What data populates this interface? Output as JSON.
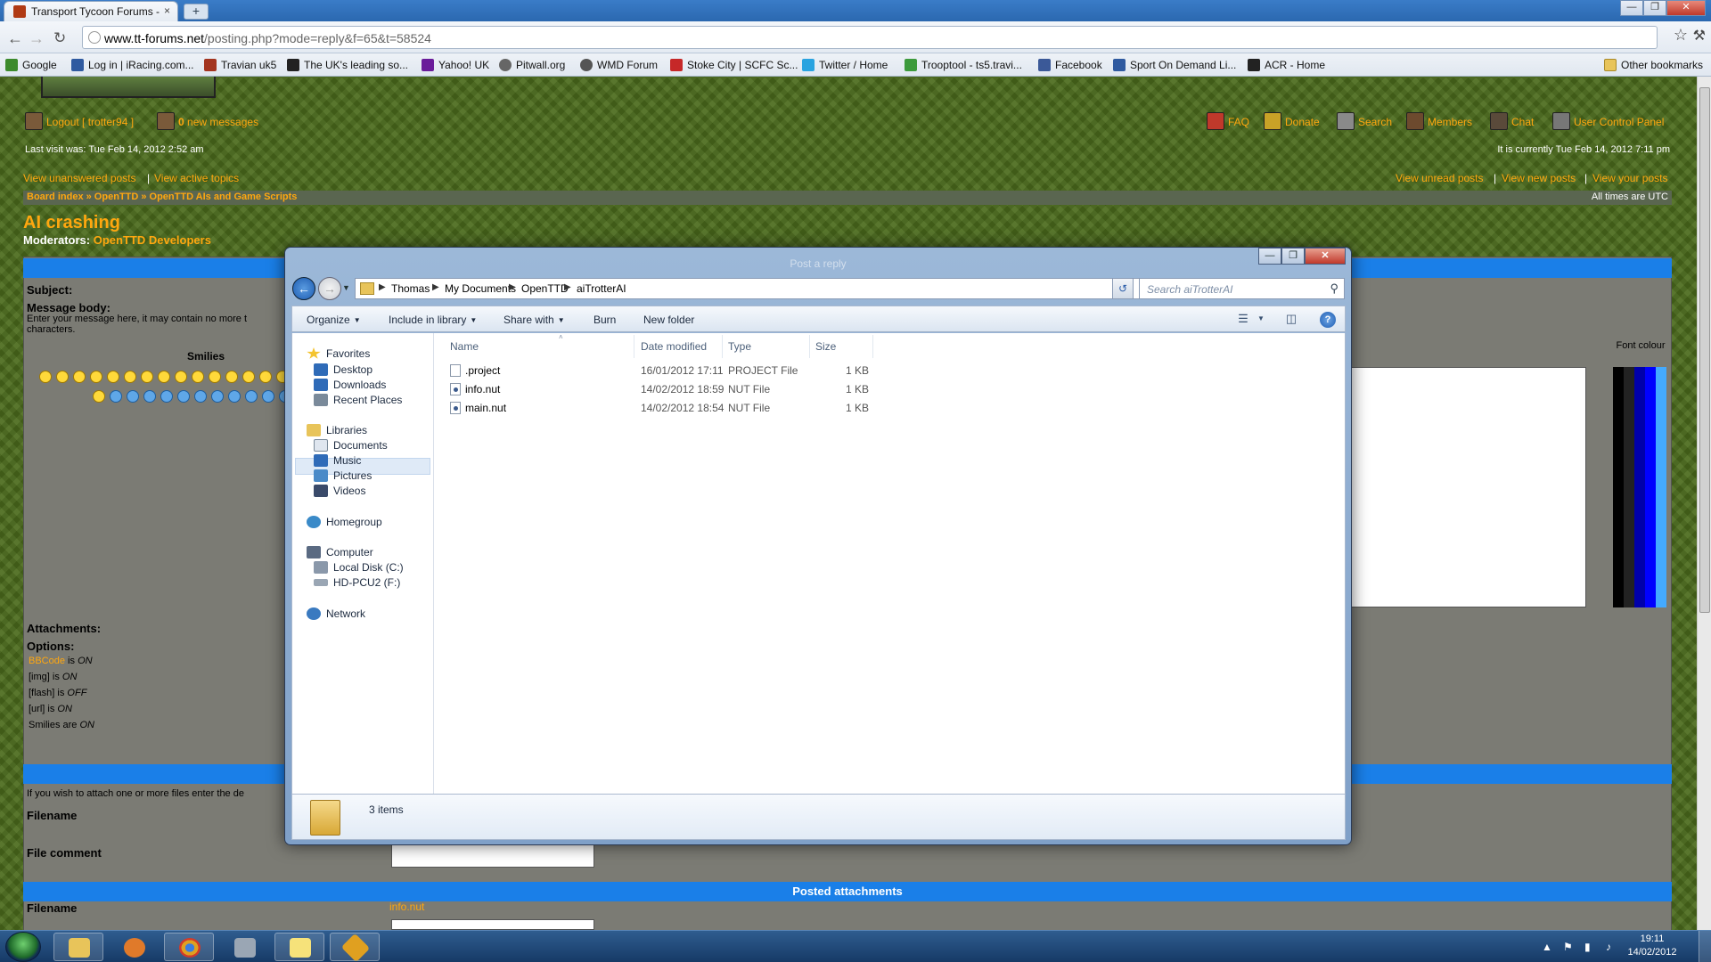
{
  "browser": {
    "tab_title": "Transport Tycoon Forums - ",
    "tab_close": "×",
    "new_tab": "+",
    "url_domain": "www.tt-forums.net",
    "url_path": "/posting.php?mode=reply&f=65&t=58524",
    "bookmarks": [
      {
        "label": "Google",
        "color": "#3c8a2c"
      },
      {
        "label": "Log in | iRacing.com...",
        "color": "#2f5aa0"
      },
      {
        "label": "Travian uk5",
        "color": "#a3341f"
      },
      {
        "label": "The UK's leading so...",
        "color": "#222222"
      },
      {
        "label": "Yahoo! UK",
        "color": "#6a1b9a"
      },
      {
        "label": "Pitwall.org",
        "color": "#666666"
      },
      {
        "label": "WMD Forum",
        "color": "#555555"
      },
      {
        "label": "Stoke City | SCFC Sc...",
        "color": "#c62828"
      },
      {
        "label": "Twitter / Home",
        "color": "#29a3e0"
      },
      {
        "label": "Trooptool - ts5.travi...",
        "color": "#3c9a3c"
      },
      {
        "label": "Facebook",
        "color": "#3b5998"
      },
      {
        "label": "Sport On Demand Li...",
        "color": "#2f5aa0"
      },
      {
        "label": "ACR - Home",
        "color": "#222222"
      }
    ],
    "other_bookmarks": "Other bookmarks"
  },
  "forum": {
    "logout": "Logout [ trotter94 ]",
    "new_messages_count": "0",
    "new_messages": "new messages",
    "faq": "FAQ",
    "donate": "Donate",
    "search": "Search",
    "members": "Members",
    "chat": "Chat",
    "ucp": "User Control Panel",
    "last_visit": "Last visit was: Tue Feb 14, 2012 2:52 am",
    "current_time": "It is currently Tue Feb 14, 2012 7:11 pm",
    "unanswered": "View unanswered posts",
    "active": "View active topics",
    "unread": "View unread posts",
    "newposts": "View new posts",
    "yourposts": "View your posts",
    "sep": "|",
    "breadcrumb": "Board index » OpenTTD » OpenTTD AIs and Game Scripts",
    "all_times": "All times are UTC",
    "topic_title": "AI crashing",
    "moderators_label": "Moderators:",
    "moderators_value": "OpenTTD Developers",
    "subject_label": "Subject:",
    "message_body_label": "Message body:",
    "message_body_hint": "Enter your message here, it may contain no more t",
    "message_body_hint2": "characters.",
    "smilies_label": "Smilies",
    "font_colour": "Font colour",
    "attachments_label": "Attachments:",
    "options_label": "Options:",
    "bbcode": "BBCode",
    "is_on": "is",
    "on": "ON",
    "off": "OFF",
    "img_opt": "[img] is",
    "flash_opt": "[flash] is",
    "url_opt": "[url] is",
    "smilies_opt": "Smilies are",
    "attach_hint": "If you wish to attach one or more files enter the de",
    "filename_label": "Filename",
    "file_comment_label": "File comment",
    "posted_attachments": "Posted attachments",
    "filename_label2": "Filename",
    "attached_file": "info.nut"
  },
  "explorer": {
    "ghost_title": "Post a reply",
    "breadcrumbs": [
      "Thomas",
      "My Documents",
      "OpenTTD",
      "aiTrotterAI"
    ],
    "search_placeholder": "Search aiTrotterAI",
    "commands": [
      "Organize",
      "Include in library",
      "Share with",
      "Burn",
      "New folder"
    ],
    "nav": {
      "favorites": "Favorites",
      "desktop": "Desktop",
      "downloads": "Downloads",
      "recent_places": "Recent Places",
      "libraries": "Libraries",
      "documents": "Documents",
      "music": "Music",
      "pictures": "Pictures",
      "videos": "Videos",
      "homegroup": "Homegroup",
      "computer": "Computer",
      "local_disk": "Local Disk (C:)",
      "hd_pcu2": "HD-PCU2 (F:)",
      "network": "Network"
    },
    "columns": {
      "name": "Name",
      "date": "Date modified",
      "type": "Type",
      "size": "Size"
    },
    "files": [
      {
        "name": ".project",
        "date": "16/01/2012 17:11",
        "type": "PROJECT File",
        "size": "1 KB",
        "kind": "plain"
      },
      {
        "name": "info.nut",
        "date": "14/02/2012 18:59",
        "type": "NUT File",
        "size": "1 KB",
        "kind": "nut"
      },
      {
        "name": "main.nut",
        "date": "14/02/2012 18:54",
        "type": "NUT File",
        "size": "1 KB",
        "kind": "nut"
      }
    ],
    "item_count": "3 items"
  },
  "taskbar": {
    "time": "19:11",
    "date": "14/02/2012"
  }
}
